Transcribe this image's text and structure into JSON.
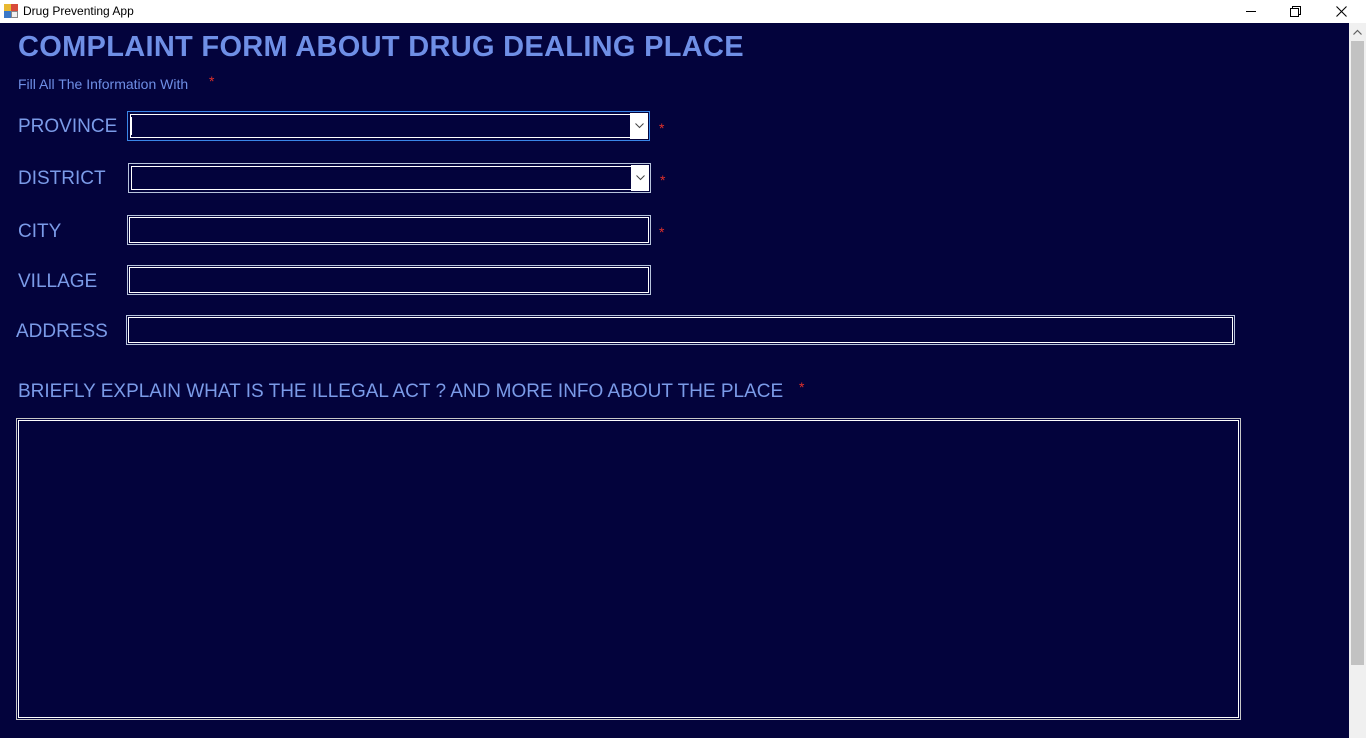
{
  "window": {
    "title": "Drug Preventing App",
    "icons": {
      "app": "app-icon",
      "minimize": "minimize-icon",
      "maximize": "restore-icon",
      "close": "close-icon"
    }
  },
  "form": {
    "title": "COMPLAINT FORM ABOUT DRUG DEALING PLACE",
    "subtitle": "Fill All The Information With",
    "required_mark": "*",
    "province": {
      "label": "PROVINCE",
      "value": ""
    },
    "district": {
      "label": "DISTRICT",
      "value": ""
    },
    "city": {
      "label": "CITY",
      "value": ""
    },
    "village": {
      "label": "VILLAGE",
      "value": ""
    },
    "address": {
      "label": "ADDRESS",
      "value": ""
    },
    "explain": {
      "label": "BRIEFLY EXPLAIN WHAT IS THE ILLEGAL ACT ?  AND MORE INFO ABOUT THE PLACE",
      "value": ""
    }
  },
  "colors": {
    "background": "#03033c",
    "label": "#7b9be8",
    "title": "#6f8fe6",
    "required": "#e0302a"
  }
}
